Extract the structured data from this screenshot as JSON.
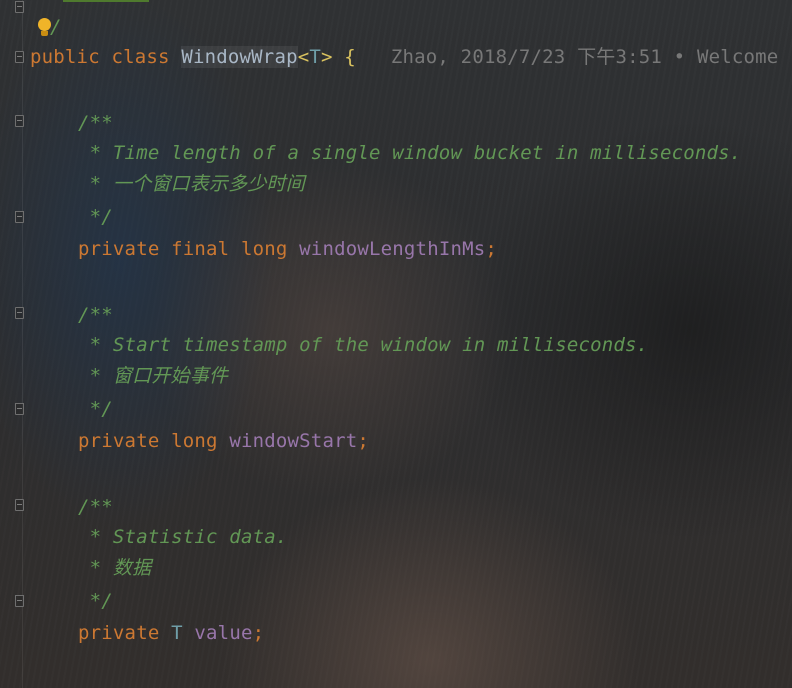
{
  "editor": {
    "line_slash": "/",
    "class_decl": {
      "modifier": "public",
      "keyword": "class",
      "name": "WindowWrap",
      "type_open": "<",
      "type_param": "T",
      "type_close": ">",
      "brace": "{"
    },
    "blame_hint": "Zhao, 2018/7/23 下午3:51 • Welcome",
    "fields": [
      {
        "comment_open": "/**",
        "comment_lines": [
          " * Time length of a single window bucket in milliseconds.",
          " * 一个窗口表示多少时间"
        ],
        "comment_close": " */",
        "modifiers": [
          "private",
          "final",
          "long"
        ],
        "name": "windowLengthInMs",
        "semicolon": ";"
      },
      {
        "comment_open": "/**",
        "comment_lines": [
          " * Start timestamp of the window in milliseconds.",
          " * 窗口开始事件"
        ],
        "comment_close": " */",
        "modifiers": [
          "private",
          "long"
        ],
        "name": "windowStart",
        "semicolon": ";"
      },
      {
        "comment_open": "/**",
        "comment_lines": [
          " * Statistic data.",
          " * 数据"
        ],
        "comment_close": " */",
        "modifiers": [
          "private"
        ],
        "type": "T",
        "name": "value",
        "semicolon": ";"
      }
    ],
    "colors": {
      "keyword": "#cc7832",
      "field": "#9876aa",
      "comment": "#629755",
      "type_param": "#6f9ea8",
      "brace": "#d9c25f",
      "hint": "#787878"
    },
    "icons": [
      "intention-bulb-icon",
      "fold-marker-icon"
    ]
  }
}
